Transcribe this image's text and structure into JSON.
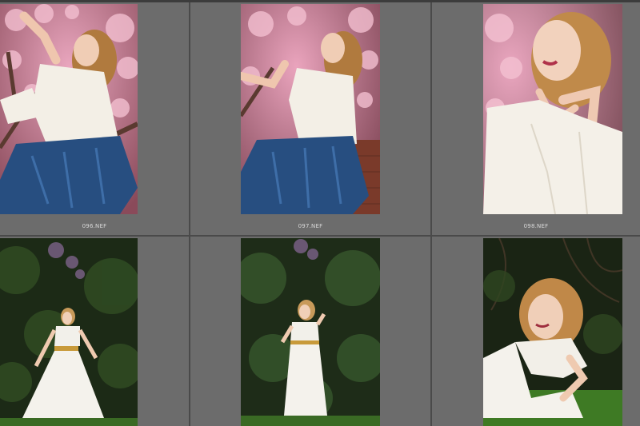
{
  "grid": {
    "cells": [
      {
        "filename": "096.NEF",
        "selected": false
      },
      {
        "filename": "097.NEF",
        "selected": false
      },
      {
        "filename": "098.NEF",
        "selected": false
      },
      {
        "filename": "",
        "selected": false
      },
      {
        "filename": "",
        "selected": false
      },
      {
        "filename": "",
        "selected": false
      }
    ]
  },
  "colors": {
    "background": "#4a4a4a",
    "cell": "#6c6c6c",
    "filename_text": "#d8d8d8"
  }
}
